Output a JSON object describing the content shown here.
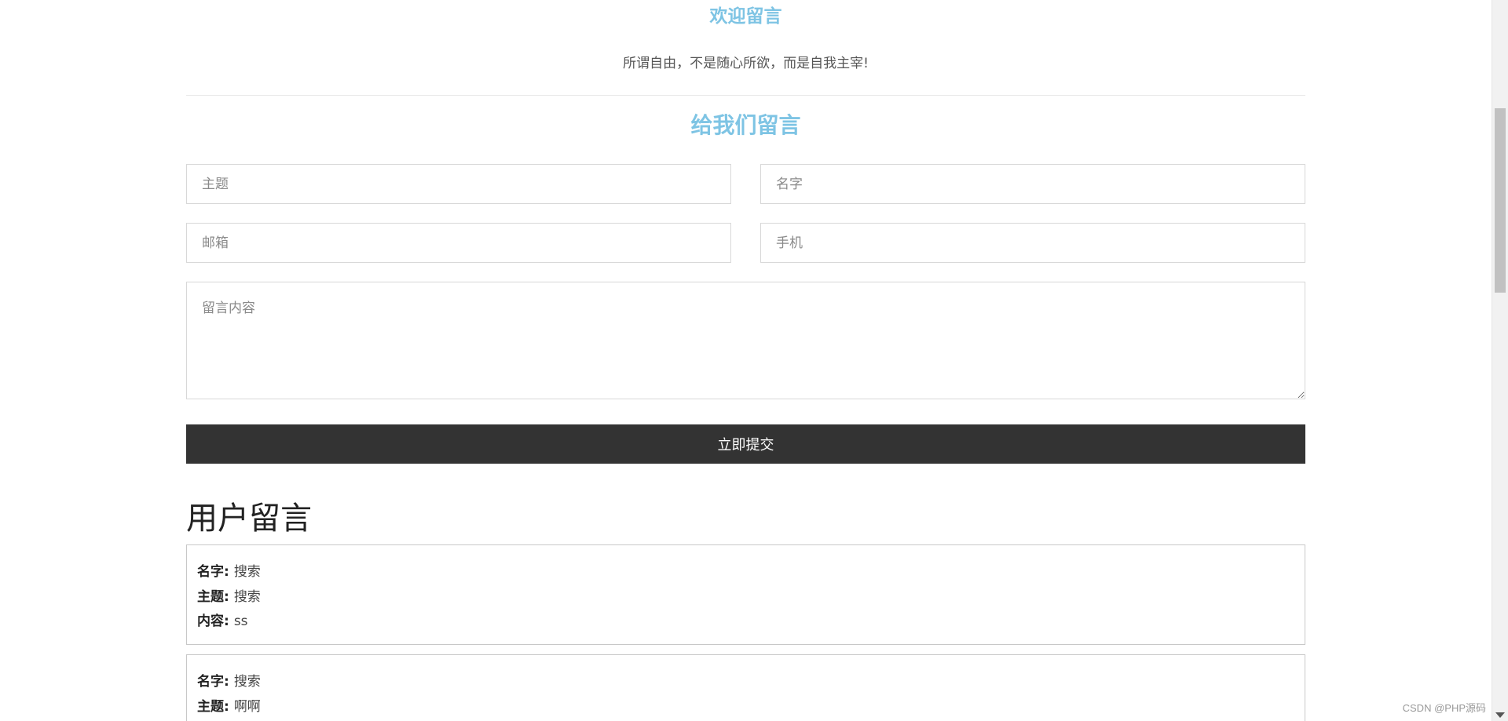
{
  "header": {
    "welcome_title": "欢迎留言",
    "welcome_subtitle": "所谓自由，不是随心所欲，而是自我主宰!"
  },
  "form": {
    "title": "给我们留言",
    "subject_placeholder": "主题",
    "name_placeholder": "名字",
    "email_placeholder": "邮箱",
    "phone_placeholder": "手机",
    "content_placeholder": "留言内容",
    "submit_label": "立即提交"
  },
  "messages": {
    "title": "用户留言",
    "name_label": "名字:",
    "subject_label": "主题:",
    "content_label": "内容:",
    "items": [
      {
        "name": "搜索",
        "subject": "搜索",
        "content": "ss"
      },
      {
        "name": "搜索",
        "subject": "啊啊"
      }
    ]
  },
  "watermark": "CSDN @PHP源码",
  "colors": {
    "accent": "#7ec4e4",
    "button_bg": "#333333"
  }
}
